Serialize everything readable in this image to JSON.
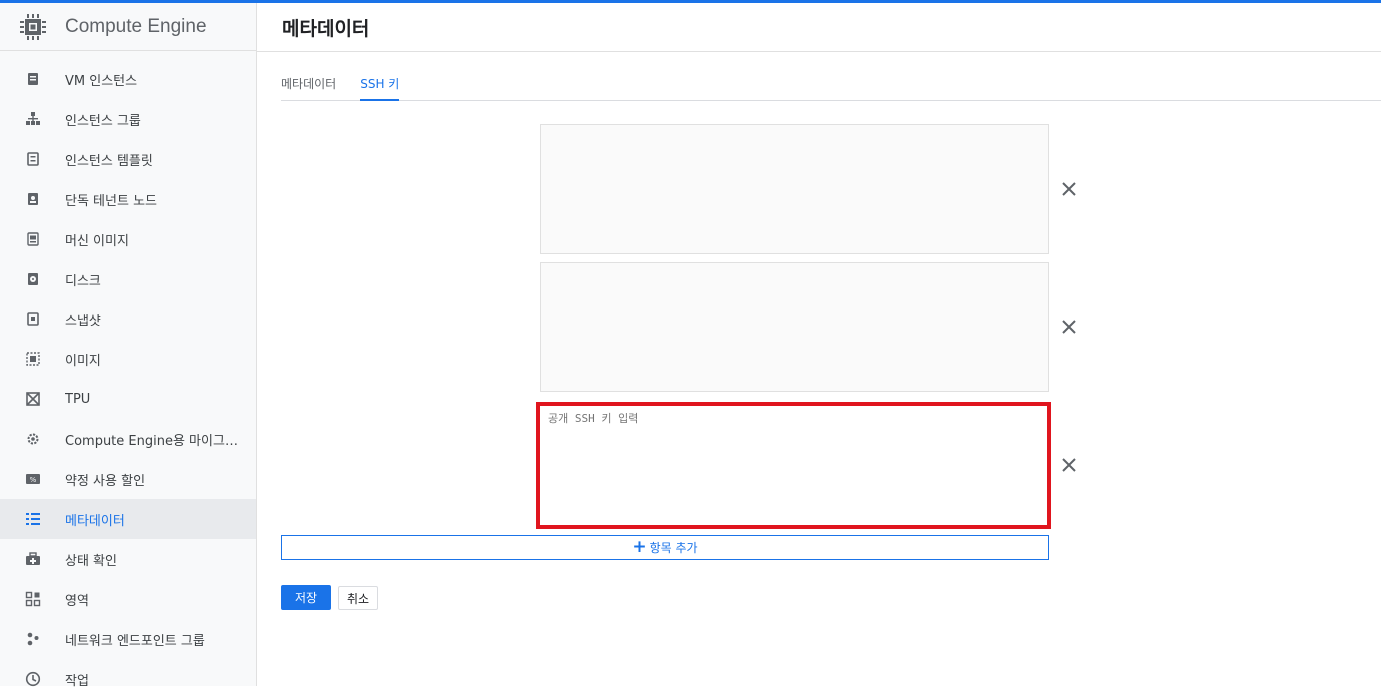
{
  "app": {
    "title": "Compute Engine"
  },
  "sidebar": {
    "items": [
      {
        "label": "VM 인스턴스",
        "icon": "vm-instance-icon"
      },
      {
        "label": "인스턴스 그룹",
        "icon": "instance-group-icon"
      },
      {
        "label": "인스턴스 템플릿",
        "icon": "instance-template-icon"
      },
      {
        "label": "단독 테넌트 노드",
        "icon": "sole-tenant-node-icon"
      },
      {
        "label": "머신 이미지",
        "icon": "machine-image-icon"
      },
      {
        "label": "디스크",
        "icon": "disk-icon"
      },
      {
        "label": "스냅샷",
        "icon": "snapshot-icon"
      },
      {
        "label": "이미지",
        "icon": "image-icon"
      },
      {
        "label": "TPU",
        "icon": "tpu-icon"
      },
      {
        "label": "Compute Engine용 마이그레…",
        "icon": "migrate-icon"
      },
      {
        "label": "약정 사용 할인",
        "icon": "committed-use-discount-icon"
      },
      {
        "label": "메타데이터",
        "icon": "metadata-icon",
        "active": true
      },
      {
        "label": "상태 확인",
        "icon": "health-check-icon"
      },
      {
        "label": "영역",
        "icon": "zones-icon"
      },
      {
        "label": "네트워크 엔드포인트 그룹",
        "icon": "network-endpoint-group-icon"
      },
      {
        "label": "작업",
        "icon": "operations-icon"
      }
    ]
  },
  "main": {
    "title": "메타데이터",
    "tabs": [
      {
        "label": "메타데이터",
        "selected": false
      },
      {
        "label": "SSH 키",
        "selected": true
      }
    ],
    "ssh_keys": [
      {
        "value": "",
        "placeholder": ""
      },
      {
        "value": "",
        "placeholder": ""
      },
      {
        "value": "",
        "placeholder": "공개 SSH 키 입력"
      }
    ],
    "add_item_label": "항목 추가",
    "save_label": "저장",
    "cancel_label": "취소"
  },
  "colors": {
    "accent": "#1a73e8",
    "highlight_border": "#e0151e"
  }
}
